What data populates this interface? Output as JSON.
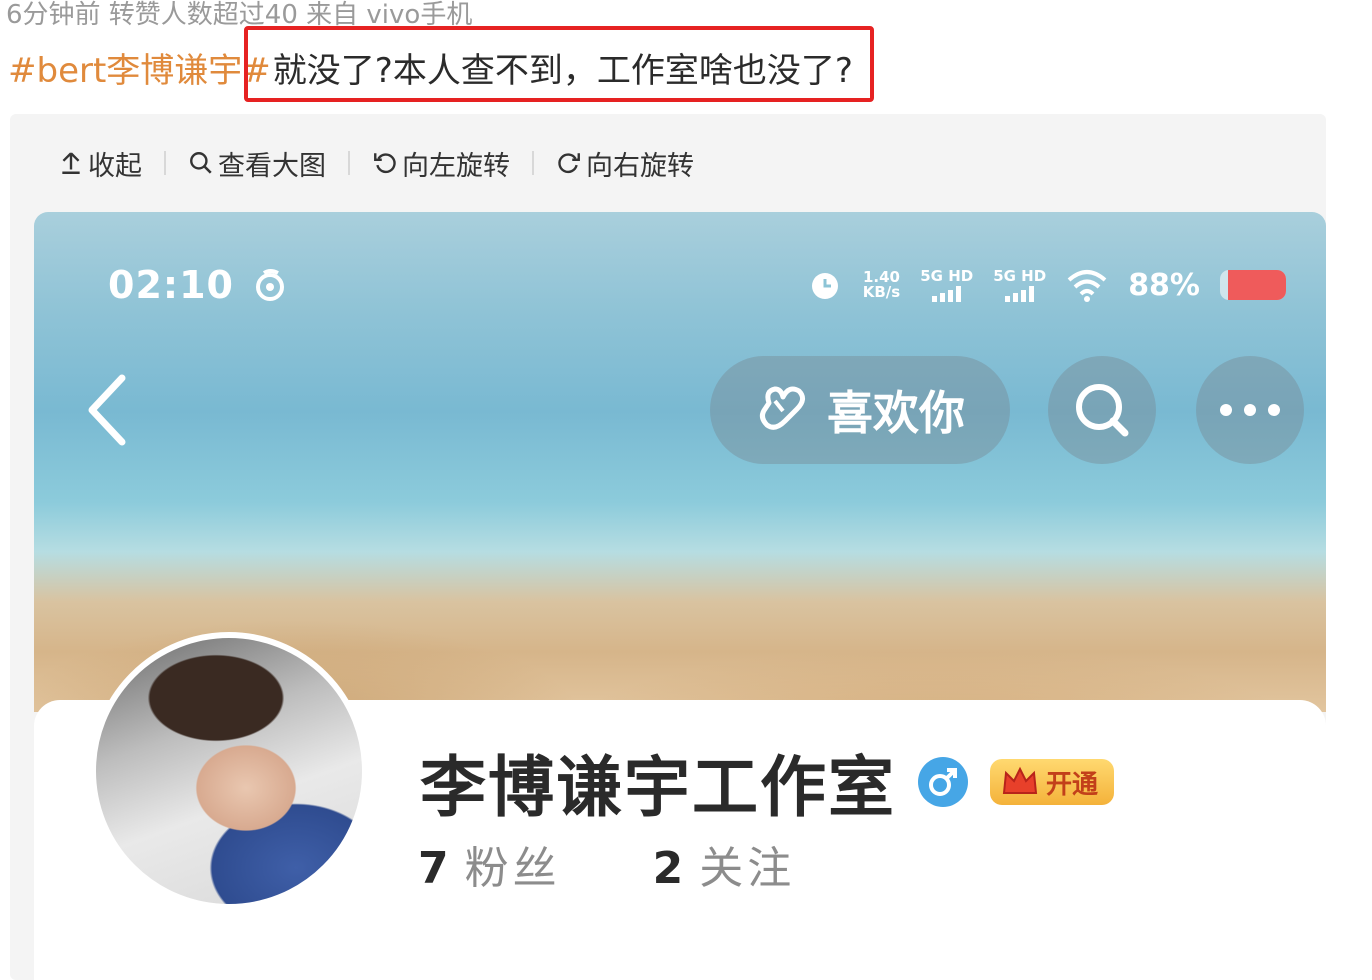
{
  "post": {
    "meta": "6分钟前 转赞人数超过40 来自 vivo手机",
    "hashtag": "#bert李博谦宇#",
    "text": "就没了?本人查不到，工作室啥也没了?"
  },
  "toolbar": {
    "collapse": "收起",
    "view_large": "查看大图",
    "rotate_left": "向左旋转",
    "rotate_right": "向右旋转"
  },
  "phone": {
    "time": "02:10",
    "net_speed_value": "1.40",
    "net_speed_unit": "KB/s",
    "signal_1": "5G HD",
    "signal_2": "5G HD",
    "battery": "88%",
    "colors": {
      "battery_fill": "#ef5b5b",
      "accent": "#46a6e6"
    }
  },
  "header": {
    "like_label": "喜欢你",
    "icons": [
      "back-icon",
      "heart-hand-icon",
      "search-icon",
      "more-icon"
    ]
  },
  "profile": {
    "name": "李博谦宇工作室",
    "vip_label": "开通",
    "followers_count": "7",
    "followers_label": "粉丝",
    "following_count": "2",
    "following_label": "关注"
  }
}
